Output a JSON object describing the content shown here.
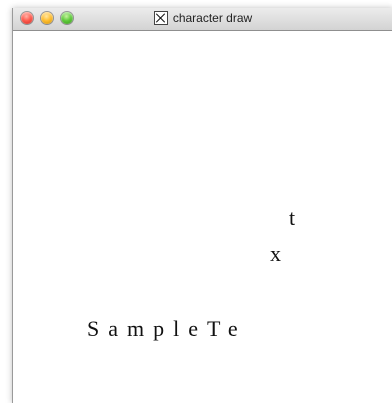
{
  "window": {
    "title": "character draw",
    "title_icon": "x-window-icon",
    "buttons": [
      "close",
      "minimize",
      "zoom"
    ]
  },
  "canvas": {
    "main_text": "SampleTe",
    "glyph_x": "x",
    "glyph_t": "t"
  },
  "colors": {
    "text": "#111111",
    "background": "#ffffff"
  }
}
